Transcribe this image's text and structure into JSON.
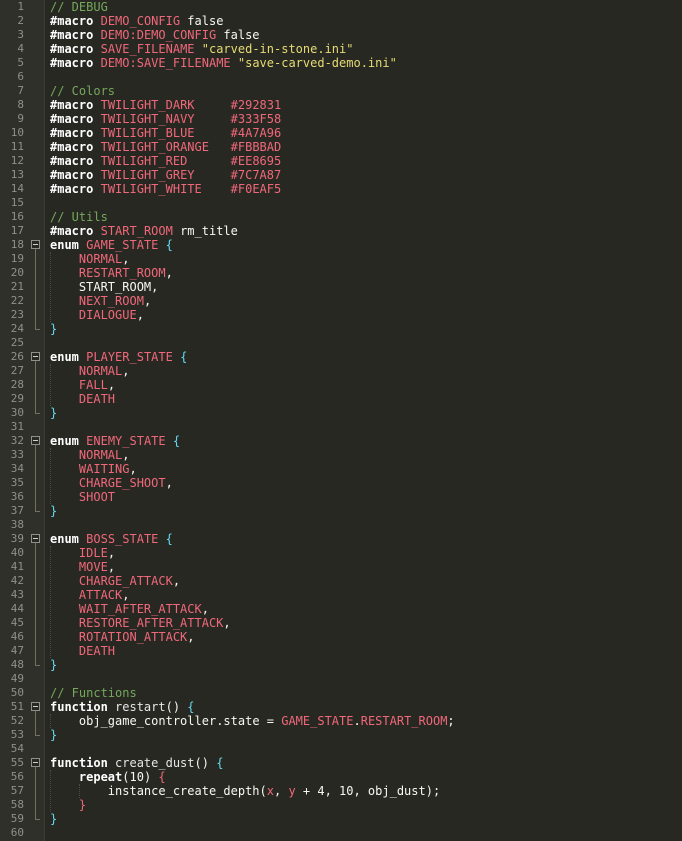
{
  "editor": {
    "lines": [
      [
        {
          "t": "// DEBUG",
          "c": "comment"
        }
      ],
      [
        {
          "t": "#macro",
          "c": "kw"
        },
        {
          "t": " "
        },
        {
          "t": "DEMO_CONFIG",
          "c": "name"
        },
        {
          "t": " false"
        }
      ],
      [
        {
          "t": "#macro",
          "c": "kw"
        },
        {
          "t": " "
        },
        {
          "t": "DEMO:DEMO_CONFIG",
          "c": "name"
        },
        {
          "t": " false"
        }
      ],
      [
        {
          "t": "#macro",
          "c": "kw"
        },
        {
          "t": " "
        },
        {
          "t": "SAVE_FILENAME",
          "c": "name"
        },
        {
          "t": " "
        },
        {
          "t": "\"carved-in-stone.ini\"",
          "c": "str"
        }
      ],
      [
        {
          "t": "#macro",
          "c": "kw"
        },
        {
          "t": " "
        },
        {
          "t": "DEMO:SAVE_FILENAME",
          "c": "name"
        },
        {
          "t": " "
        },
        {
          "t": "\"save-carved-demo.ini\"",
          "c": "str"
        }
      ],
      [],
      [
        {
          "t": "// Colors",
          "c": "comment"
        }
      ],
      [
        {
          "t": "#macro",
          "c": "kw"
        },
        {
          "t": " "
        },
        {
          "t": "TWILIGHT_DARK",
          "c": "name"
        },
        {
          "t": "     "
        },
        {
          "t": "#292831",
          "c": "name"
        }
      ],
      [
        {
          "t": "#macro",
          "c": "kw"
        },
        {
          "t": " "
        },
        {
          "t": "TWILIGHT_NAVY",
          "c": "name"
        },
        {
          "t": "     "
        },
        {
          "t": "#333F58",
          "c": "name"
        }
      ],
      [
        {
          "t": "#macro",
          "c": "kw"
        },
        {
          "t": " "
        },
        {
          "t": "TWILIGHT_BLUE",
          "c": "name"
        },
        {
          "t": "     "
        },
        {
          "t": "#4A7A96",
          "c": "name"
        }
      ],
      [
        {
          "t": "#macro",
          "c": "kw"
        },
        {
          "t": " "
        },
        {
          "t": "TWILIGHT_ORANGE",
          "c": "name"
        },
        {
          "t": "   "
        },
        {
          "t": "#FBBBAD",
          "c": "name"
        }
      ],
      [
        {
          "t": "#macro",
          "c": "kw"
        },
        {
          "t": " "
        },
        {
          "t": "TWILIGHT_RED",
          "c": "name"
        },
        {
          "t": "      "
        },
        {
          "t": "#EE8695",
          "c": "name"
        }
      ],
      [
        {
          "t": "#macro",
          "c": "kw"
        },
        {
          "t": " "
        },
        {
          "t": "TWILIGHT_GREY",
          "c": "name"
        },
        {
          "t": "     "
        },
        {
          "t": "#7C7A87",
          "c": "name"
        }
      ],
      [
        {
          "t": "#macro",
          "c": "kw"
        },
        {
          "t": " "
        },
        {
          "t": "TWILIGHT_WHITE",
          "c": "name"
        },
        {
          "t": "    "
        },
        {
          "t": "#F0EAF5",
          "c": "name"
        }
      ],
      [],
      [
        {
          "t": "// Utils",
          "c": "comment"
        }
      ],
      [
        {
          "t": "#macro",
          "c": "kw"
        },
        {
          "t": " "
        },
        {
          "t": "START_ROOM",
          "c": "name"
        },
        {
          "t": " rm_title"
        }
      ],
      [
        {
          "t": "enum",
          "c": "kw"
        },
        {
          "t": " "
        },
        {
          "t": "GAME_STATE",
          "c": "name"
        },
        {
          "t": " "
        },
        {
          "t": "{",
          "c": "brace"
        }
      ],
      [
        {
          "t": "    "
        },
        {
          "t": "NORMAL",
          "c": "name"
        },
        {
          "t": ","
        }
      ],
      [
        {
          "t": "    "
        },
        {
          "t": "RESTART_ROOM",
          "c": "name"
        },
        {
          "t": ","
        }
      ],
      [
        {
          "t": "    "
        },
        {
          "t": "START_ROOM",
          "c": "plain"
        },
        {
          "t": ","
        }
      ],
      [
        {
          "t": "    "
        },
        {
          "t": "NEXT_ROOM",
          "c": "name"
        },
        {
          "t": ","
        }
      ],
      [
        {
          "t": "    "
        },
        {
          "t": "DIALOGUE",
          "c": "name"
        },
        {
          "t": ","
        }
      ],
      [
        {
          "t": "}",
          "c": "brace"
        }
      ],
      [],
      [
        {
          "t": "enum",
          "c": "kw"
        },
        {
          "t": " "
        },
        {
          "t": "PLAYER_STATE",
          "c": "name"
        },
        {
          "t": " "
        },
        {
          "t": "{",
          "c": "brace"
        }
      ],
      [
        {
          "t": "    "
        },
        {
          "t": "NORMAL",
          "c": "name"
        },
        {
          "t": ","
        }
      ],
      [
        {
          "t": "    "
        },
        {
          "t": "FALL",
          "c": "name"
        },
        {
          "t": ","
        }
      ],
      [
        {
          "t": "    "
        },
        {
          "t": "DEATH",
          "c": "name"
        }
      ],
      [
        {
          "t": "}",
          "c": "brace"
        }
      ],
      [],
      [
        {
          "t": "enum",
          "c": "kw"
        },
        {
          "t": " "
        },
        {
          "t": "ENEMY_STATE",
          "c": "name"
        },
        {
          "t": " "
        },
        {
          "t": "{",
          "c": "brace"
        }
      ],
      [
        {
          "t": "    "
        },
        {
          "t": "NORMAL",
          "c": "name"
        },
        {
          "t": ","
        }
      ],
      [
        {
          "t": "    "
        },
        {
          "t": "WAITING",
          "c": "name"
        },
        {
          "t": ","
        }
      ],
      [
        {
          "t": "    "
        },
        {
          "t": "CHARGE_SHOOT",
          "c": "name"
        },
        {
          "t": ","
        }
      ],
      [
        {
          "t": "    "
        },
        {
          "t": "SHOOT",
          "c": "name"
        }
      ],
      [
        {
          "t": "}",
          "c": "brace"
        }
      ],
      [],
      [
        {
          "t": "enum",
          "c": "kw"
        },
        {
          "t": " "
        },
        {
          "t": "BOSS_STATE",
          "c": "name"
        },
        {
          "t": " "
        },
        {
          "t": "{",
          "c": "brace"
        }
      ],
      [
        {
          "t": "    "
        },
        {
          "t": "IDLE",
          "c": "name"
        },
        {
          "t": ","
        }
      ],
      [
        {
          "t": "    "
        },
        {
          "t": "MOVE",
          "c": "name"
        },
        {
          "t": ","
        }
      ],
      [
        {
          "t": "    "
        },
        {
          "t": "CHARGE_ATTACK",
          "c": "name"
        },
        {
          "t": ","
        }
      ],
      [
        {
          "t": "    "
        },
        {
          "t": "ATTACK",
          "c": "name"
        },
        {
          "t": ","
        }
      ],
      [
        {
          "t": "    "
        },
        {
          "t": "WAIT_AFTER_ATTACK",
          "c": "name"
        },
        {
          "t": ","
        }
      ],
      [
        {
          "t": "    "
        },
        {
          "t": "RESTORE_AFTER_ATTACK",
          "c": "name"
        },
        {
          "t": ","
        }
      ],
      [
        {
          "t": "    "
        },
        {
          "t": "ROTATION_ATTACK",
          "c": "name"
        },
        {
          "t": ","
        }
      ],
      [
        {
          "t": "    "
        },
        {
          "t": "DEATH",
          "c": "name"
        }
      ],
      [
        {
          "t": "}",
          "c": "brace"
        }
      ],
      [],
      [
        {
          "t": "// Functions",
          "c": "comment"
        }
      ],
      [
        {
          "t": "function",
          "c": "kw"
        },
        {
          "t": " "
        },
        {
          "t": "restart",
          "c": "func"
        },
        {
          "t": "() "
        },
        {
          "t": "{",
          "c": "brace"
        }
      ],
      [
        {
          "t": "    "
        },
        {
          "t": "obj_game_controller",
          "c": "plain"
        },
        {
          "t": "."
        },
        {
          "t": "state",
          "c": "plain"
        },
        {
          "t": " = "
        },
        {
          "t": "GAME_STATE",
          "c": "name"
        },
        {
          "t": "."
        },
        {
          "t": "RESTART_ROOM",
          "c": "name"
        },
        {
          "t": ";"
        }
      ],
      [
        {
          "t": "}",
          "c": "brace"
        }
      ],
      [],
      [
        {
          "t": "function",
          "c": "kw"
        },
        {
          "t": " "
        },
        {
          "t": "create_dust",
          "c": "func"
        },
        {
          "t": "() "
        },
        {
          "t": "{",
          "c": "brace"
        }
      ],
      [
        {
          "t": "    "
        },
        {
          "t": "repeat",
          "c": "kw"
        },
        {
          "t": "(10) "
        },
        {
          "t": "{",
          "c": "red"
        }
      ],
      [
        {
          "t": "        "
        },
        {
          "t": "instance_create_depth",
          "c": "plain"
        },
        {
          "t": "("
        },
        {
          "t": "x",
          "c": "name"
        },
        {
          "t": ", "
        },
        {
          "t": "y",
          "c": "name"
        },
        {
          "t": " + 4, 10, "
        },
        {
          "t": "obj_dust",
          "c": "plain"
        },
        {
          "t": ");"
        }
      ],
      [
        {
          "t": "    "
        },
        {
          "t": "}",
          "c": "red"
        }
      ],
      [
        {
          "t": "}",
          "c": "brace"
        }
      ],
      []
    ],
    "line_numbers": [
      "1",
      "2",
      "3",
      "4",
      "5",
      "6",
      "7",
      "8",
      "9",
      "10",
      "11",
      "12",
      "13",
      "14",
      "15",
      "16",
      "17",
      "18",
      "19",
      "20",
      "21",
      "22",
      "23",
      "24",
      "25",
      "26",
      "27",
      "28",
      "29",
      "30",
      "31",
      "32",
      "33",
      "34",
      "35",
      "36",
      "37",
      "38",
      "39",
      "40",
      "41",
      "42",
      "43",
      "44",
      "45",
      "46",
      "47",
      "48",
      "49",
      "50",
      "51",
      "52",
      "53",
      "54",
      "55",
      "56",
      "57",
      "58",
      "59",
      "60"
    ],
    "folds": [
      {
        "start": 18,
        "end": 24
      },
      {
        "start": 26,
        "end": 30
      },
      {
        "start": 32,
        "end": 37
      },
      {
        "start": 39,
        "end": 48
      },
      {
        "start": 51,
        "end": 53
      },
      {
        "start": 55,
        "end": 59
      }
    ],
    "colors": {
      "background": "#272822",
      "gutter": "#2f302a",
      "comment": "#75a85c",
      "keyword": "#ffffff",
      "identifier": "#f0687a",
      "string": "#e6db74",
      "brace": "#66d9ef"
    }
  }
}
